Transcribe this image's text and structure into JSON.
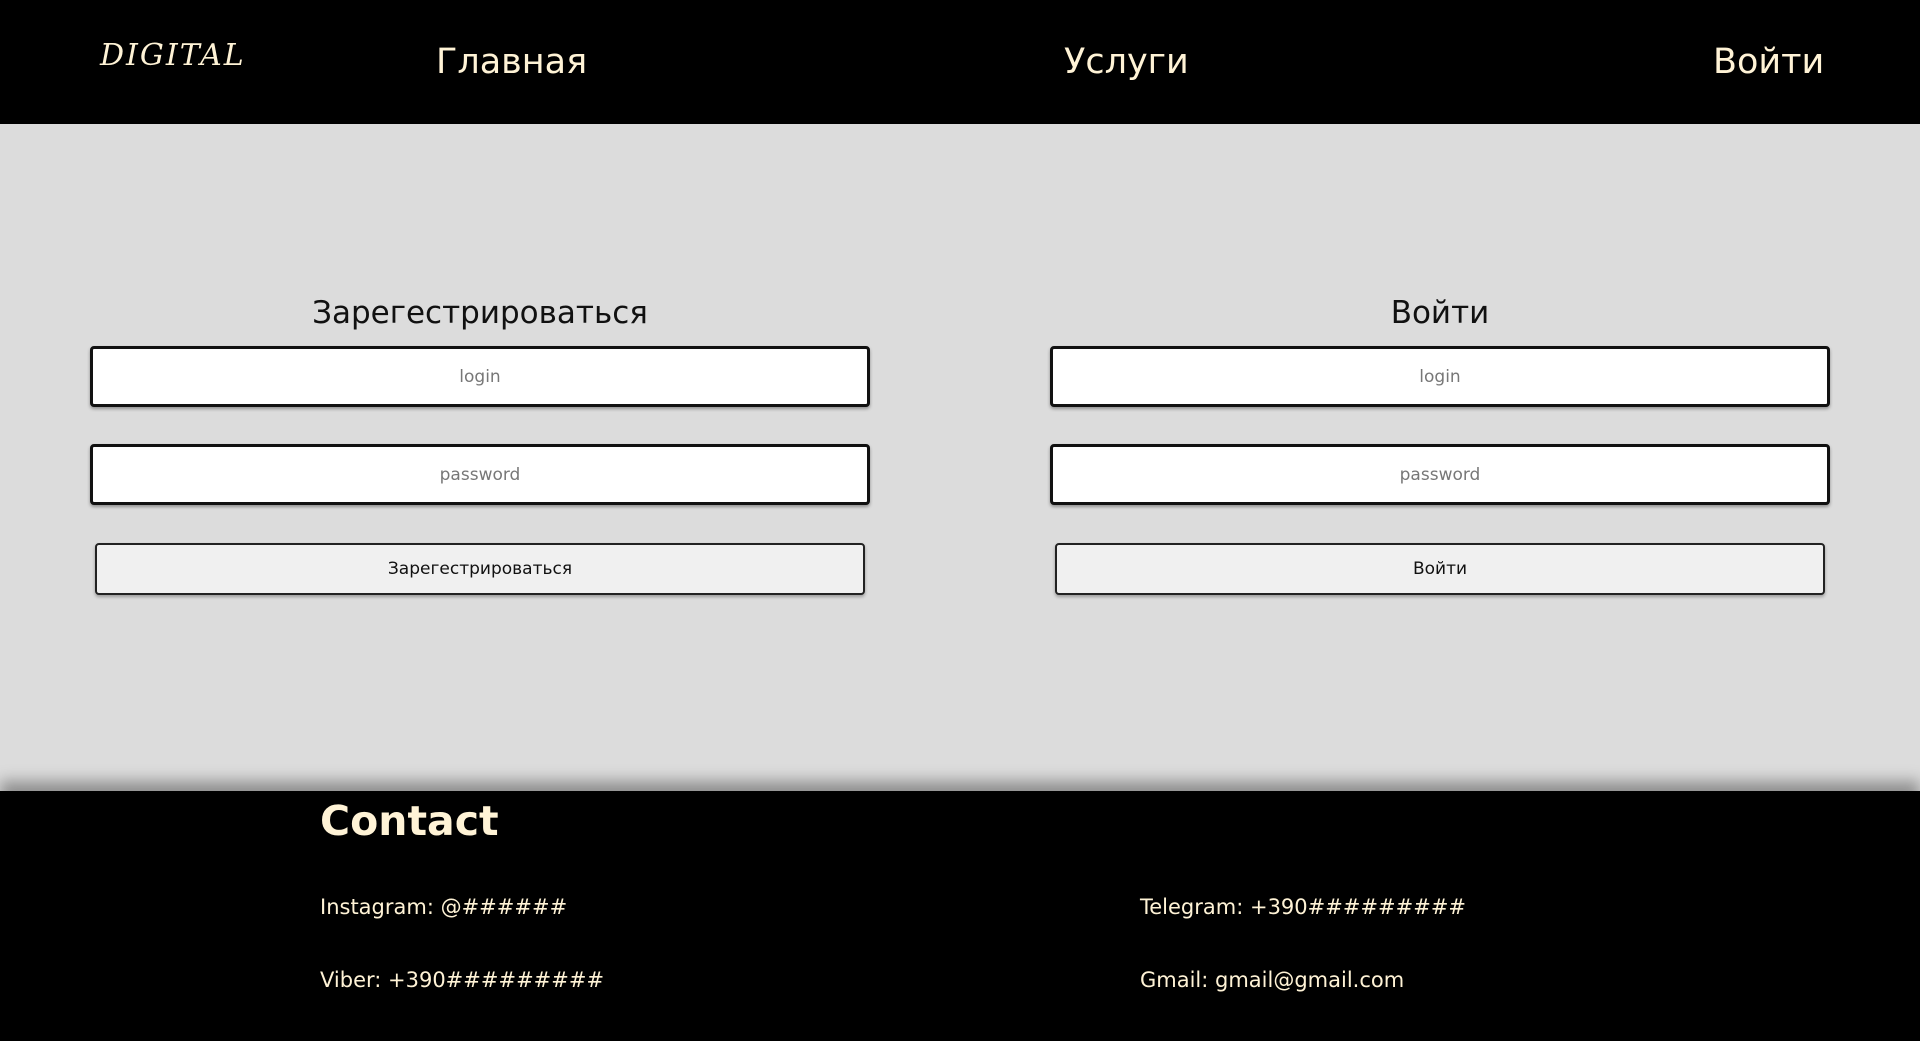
{
  "header": {
    "logo": "DIGITAL",
    "nav": {
      "home": "Главная",
      "services": "Услуги",
      "login": "Войти"
    }
  },
  "register": {
    "title": "Зарегестрироваться",
    "login_placeholder": "login",
    "password_placeholder": "password",
    "button_label": "Зарегестрироваться"
  },
  "signin": {
    "title": "Войти",
    "login_placeholder": "login",
    "password_placeholder": "password",
    "button_label": "Войти"
  },
  "footer": {
    "title": "Contact",
    "instagram": "Instagram: @######",
    "telegram": "Telegram: +390#########",
    "viber": "Viber: +390#########",
    "gmail": "Gmail: gmail@gmail.com"
  },
  "colors": {
    "header_bg": "#000000",
    "body_bg": "#dcdcdc",
    "accent_text": "#fff3d6"
  }
}
